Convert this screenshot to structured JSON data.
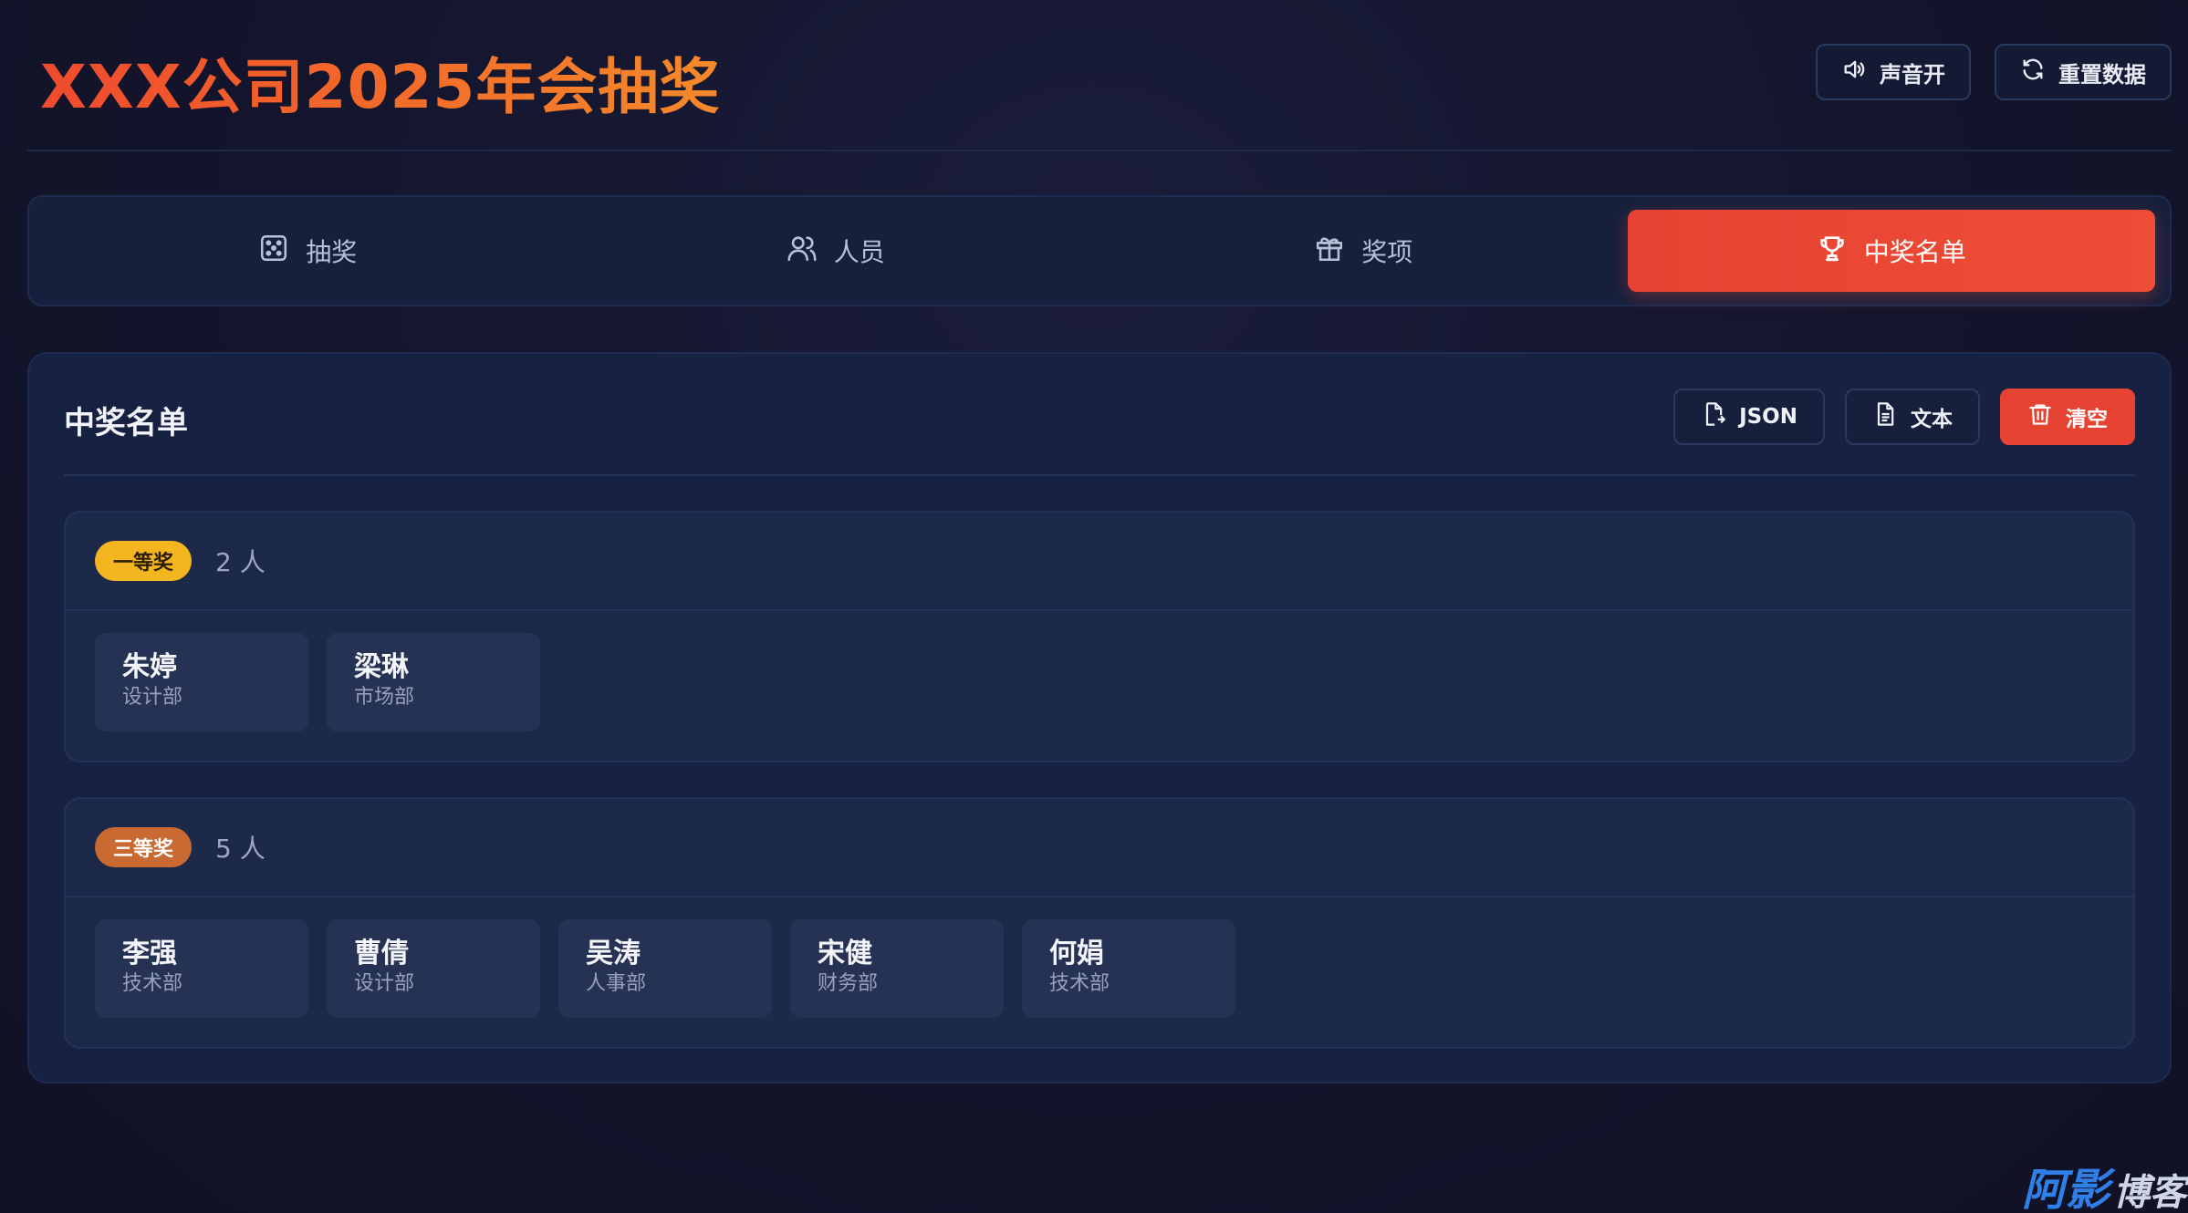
{
  "header": {
    "title": "XXX公司2025年会抽奖",
    "sound_button": "声音开",
    "reset_button": "重置数据"
  },
  "tabs": [
    {
      "label": "抽奖",
      "icon": "dice-icon",
      "active": false
    },
    {
      "label": "人员",
      "icon": "users-icon",
      "active": false
    },
    {
      "label": "奖项",
      "icon": "gift-icon",
      "active": false
    },
    {
      "label": "中奖名单",
      "icon": "trophy-icon",
      "active": true
    }
  ],
  "panel": {
    "title": "中奖名单",
    "export_json": "JSON",
    "export_text": "文本",
    "clear": "清空"
  },
  "prize_groups": [
    {
      "prize": "一等奖",
      "count": "2 人",
      "badge_color": "#f3b620",
      "winners": [
        {
          "name": "朱婷",
          "dept": "设计部"
        },
        {
          "name": "梁琳",
          "dept": "市场部"
        }
      ]
    },
    {
      "prize": "三等奖",
      "count": "5 人",
      "badge_color": "#c86a32",
      "winners": [
        {
          "name": "李强",
          "dept": "技术部"
        },
        {
          "name": "曹倩",
          "dept": "设计部"
        },
        {
          "name": "吴涛",
          "dept": "人事部"
        },
        {
          "name": "宋健",
          "dept": "财务部"
        },
        {
          "name": "何娟",
          "dept": "技术部"
        }
      ]
    }
  ],
  "watermark": {
    "part1": "阿影",
    "part2": "博客"
  },
  "colors": {
    "accent": "#e64332",
    "title_gradient_start": "#ef4a2e",
    "title_gradient_end": "#f5892a"
  }
}
